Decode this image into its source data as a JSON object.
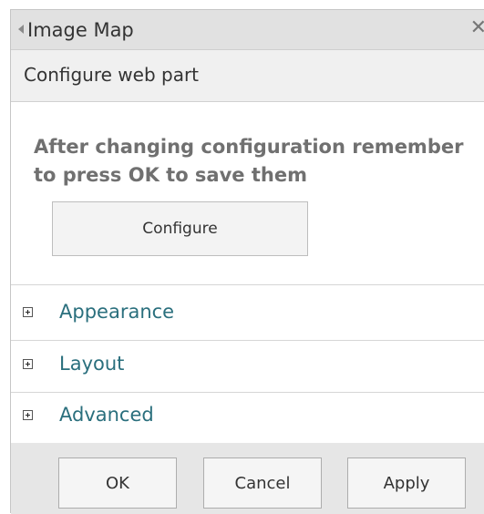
{
  "window": {
    "title": "Image Map",
    "close_glyph": "✕"
  },
  "section": {
    "title": "Configure web part"
  },
  "notice": {
    "text": "After changing configuration remember to press OK to save them"
  },
  "configure_button": {
    "label": "Configure"
  },
  "groups": [
    {
      "label": "Appearance",
      "icon": "plus-expand-icon"
    },
    {
      "label": "Layout",
      "icon": "plus-expand-icon"
    },
    {
      "label": "Advanced",
      "icon": "plus-expand-icon"
    }
  ],
  "footer": {
    "ok_label": "OK",
    "cancel_label": "Cancel",
    "apply_label": "Apply"
  },
  "colors": {
    "group_label": "#2a6f7d",
    "title_bar": "#e1e1e1",
    "section_bar": "#f0f0f0",
    "footer_bar": "#e6e6e6"
  }
}
